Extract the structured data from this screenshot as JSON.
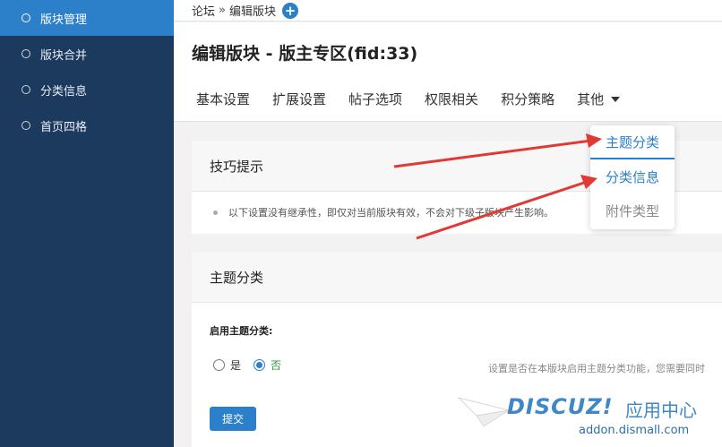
{
  "sidebar": {
    "items": [
      {
        "label": "版块管理",
        "active": true
      },
      {
        "label": "版块合并",
        "active": false
      },
      {
        "label": "分类信息",
        "active": false
      },
      {
        "label": "首页四格",
        "active": false
      }
    ]
  },
  "breadcrumb": {
    "root": "论坛",
    "separator": "»",
    "current": "编辑版块",
    "add_icon": "plus-icon"
  },
  "page": {
    "title": "编辑版块 - 版主专区(fid:33)"
  },
  "tabs": [
    {
      "label": "基本设置"
    },
    {
      "label": "扩展设置"
    },
    {
      "label": "帖子选项"
    },
    {
      "label": "权限相关"
    },
    {
      "label": "积分策略"
    },
    {
      "label": "其他"
    }
  ],
  "dropdown": {
    "items": [
      "主题分类",
      "分类信息",
      "附件类型"
    ]
  },
  "tips_panel": {
    "title": "技巧提示",
    "text": "以下设置没有继承性，即仅对当前版块有效，不会对下级子版块产生影响。"
  },
  "category_panel": {
    "title": "主题分类",
    "field_label": "启用主题分类:",
    "option_yes": "是",
    "option_no": "否",
    "selected": "否",
    "description": "设置是否在本版块启用主题分类功能，您需要同时",
    "submit_label": "提交"
  },
  "watermark": {
    "logo": "DISCUZ!",
    "cn": "应用中心",
    "url": "addon.dismall.com"
  },
  "colors": {
    "sidebar_bg": "#1c3a5e",
    "sidebar_active": "#2c7fc9",
    "accent": "#2c7fc9",
    "arrow": "#e03a35",
    "selected_green": "#2a9a3a"
  }
}
